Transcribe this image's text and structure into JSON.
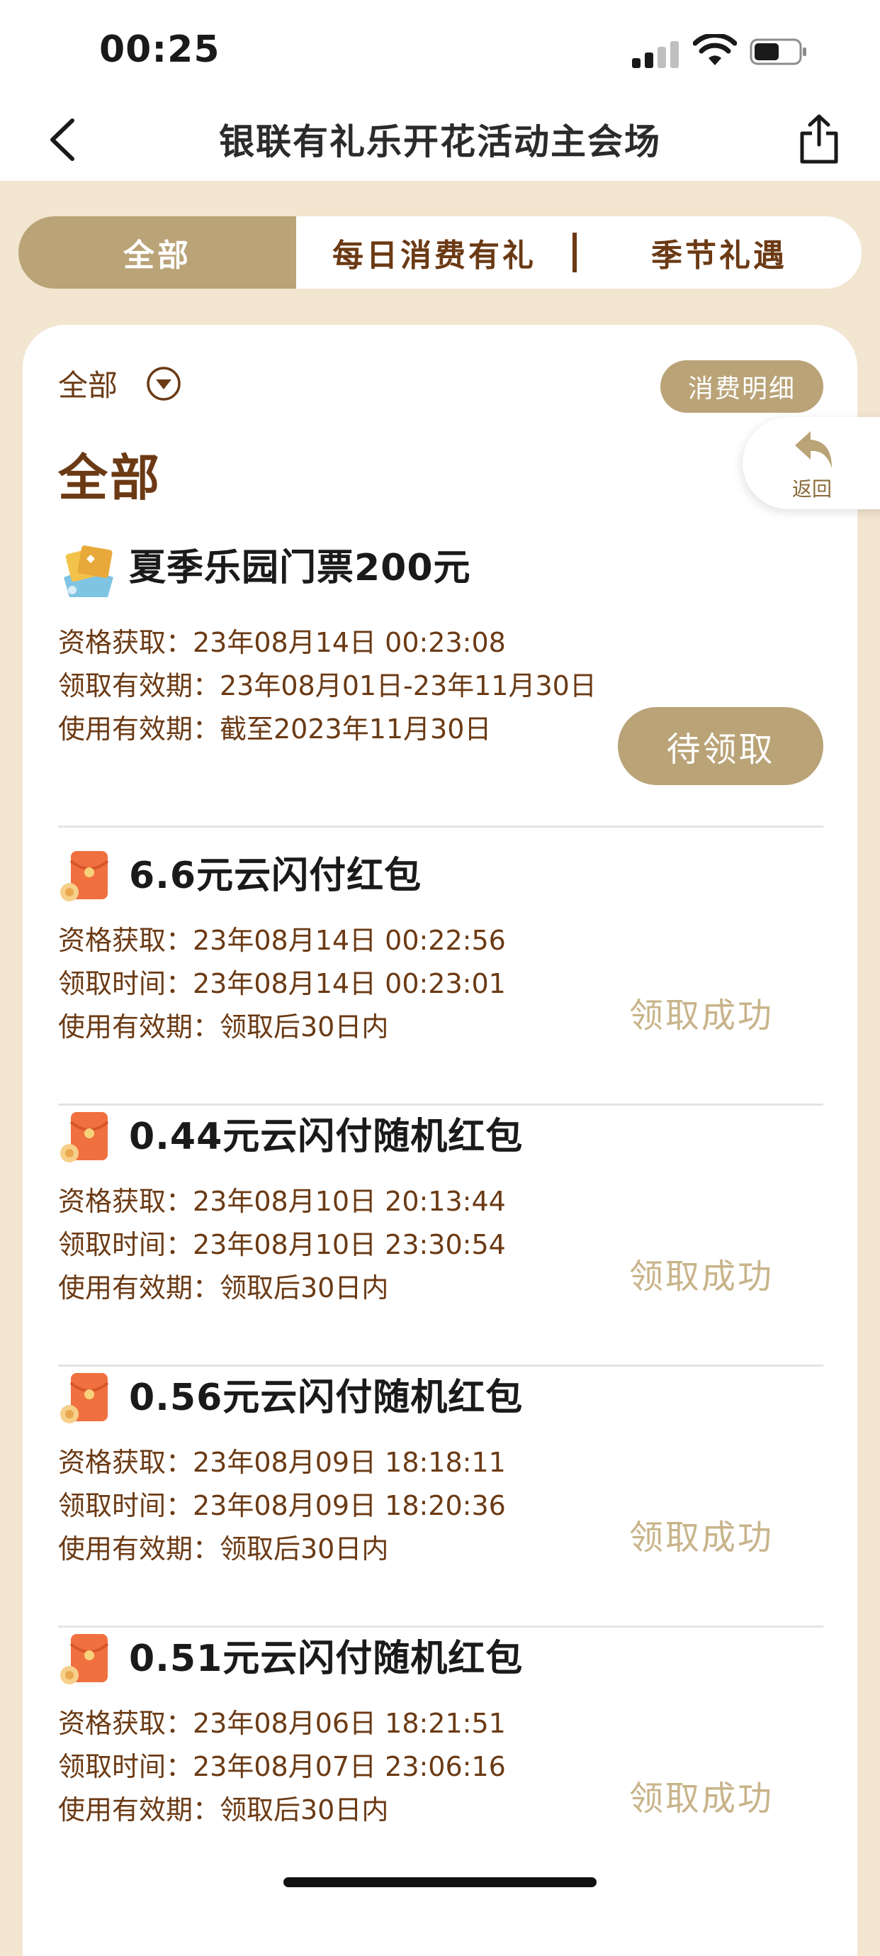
{
  "status_bar": {
    "time": "00:25"
  },
  "nav": {
    "title": "银联有礼乐开花活动主会场"
  },
  "tabs": [
    {
      "label": "全部"
    },
    {
      "label": "每日消费有礼"
    },
    {
      "label": "季节礼遇"
    }
  ],
  "filter": {
    "label": "全部"
  },
  "detail_button": "消费明细",
  "return_button": "返回",
  "section_title": "全部",
  "colors": {
    "accent": "#b9a377",
    "brown": "#6b3a14",
    "success": "#c8b48a",
    "background": "#f2e6d0"
  },
  "items": [
    {
      "icon": "ticket-gift-icon",
      "title": "夏季乐园门票200元",
      "lines": [
        "资格获取：23年08月14日 00:23:08",
        "领取有效期：23年08月01日-23年11月30日",
        "使用有效期：截至2023年11月30日"
      ],
      "status": "待领取"
    },
    {
      "icon": "red-envelope-icon",
      "title": "6.6元云闪付红包",
      "lines": [
        "资格获取：23年08月14日 00:22:56",
        "领取时间：23年08月14日 00:23:01",
        "使用有效期：领取后30日内"
      ],
      "status": "领取成功"
    },
    {
      "icon": "red-envelope-icon",
      "title": "0.44元云闪付随机红包",
      "lines": [
        "资格获取：23年08月10日 20:13:44",
        "领取时间：23年08月10日 23:30:54",
        "使用有效期：领取后30日内"
      ],
      "status": "领取成功"
    },
    {
      "icon": "red-envelope-icon",
      "title": "0.56元云闪付随机红包",
      "lines": [
        "资格获取：23年08月09日 18:18:11",
        "领取时间：23年08月09日 18:20:36",
        "使用有效期：领取后30日内"
      ],
      "status": "领取成功"
    },
    {
      "icon": "red-envelope-icon",
      "title": "0.51元云闪付随机红包",
      "lines": [
        "资格获取：23年08月06日 18:21:51",
        "领取时间：23年08月07日 23:06:16",
        "使用有效期：领取后30日内"
      ],
      "status": "领取成功"
    }
  ]
}
